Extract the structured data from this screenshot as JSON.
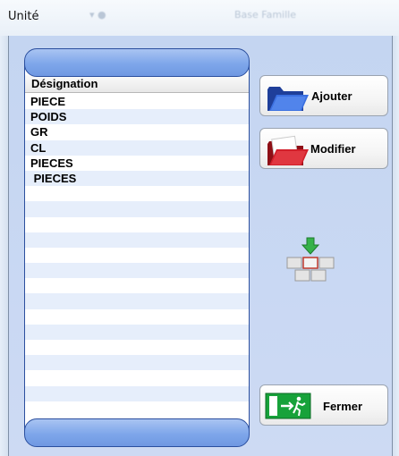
{
  "window": {
    "title": "Unité",
    "ghost_title": "Base Famille"
  },
  "list": {
    "header": "Désignation",
    "rows": [
      "PIECE",
      "POIDS",
      "GR",
      "CL",
      "PIECES",
      " PIECES",
      "",
      "",
      "",
      "",
      "",
      "",
      "",
      "",
      "",
      "",
      "",
      "",
      "",
      "",
      ""
    ]
  },
  "buttons": {
    "add_label": "Ajouter",
    "edit_label": "Modifier",
    "close_label": "Fermer"
  },
  "icons": {
    "add": "blue-folder-icon",
    "edit": "red-folder-icon",
    "move": "insert-arrow-blocks-icon",
    "close": "exit-door-icon"
  },
  "colors": {
    "client_background": "#c9d8f3",
    "list_cap": "#7ea6ea",
    "row_alt": "#e6eefb",
    "exit_green": "#17a23a"
  }
}
